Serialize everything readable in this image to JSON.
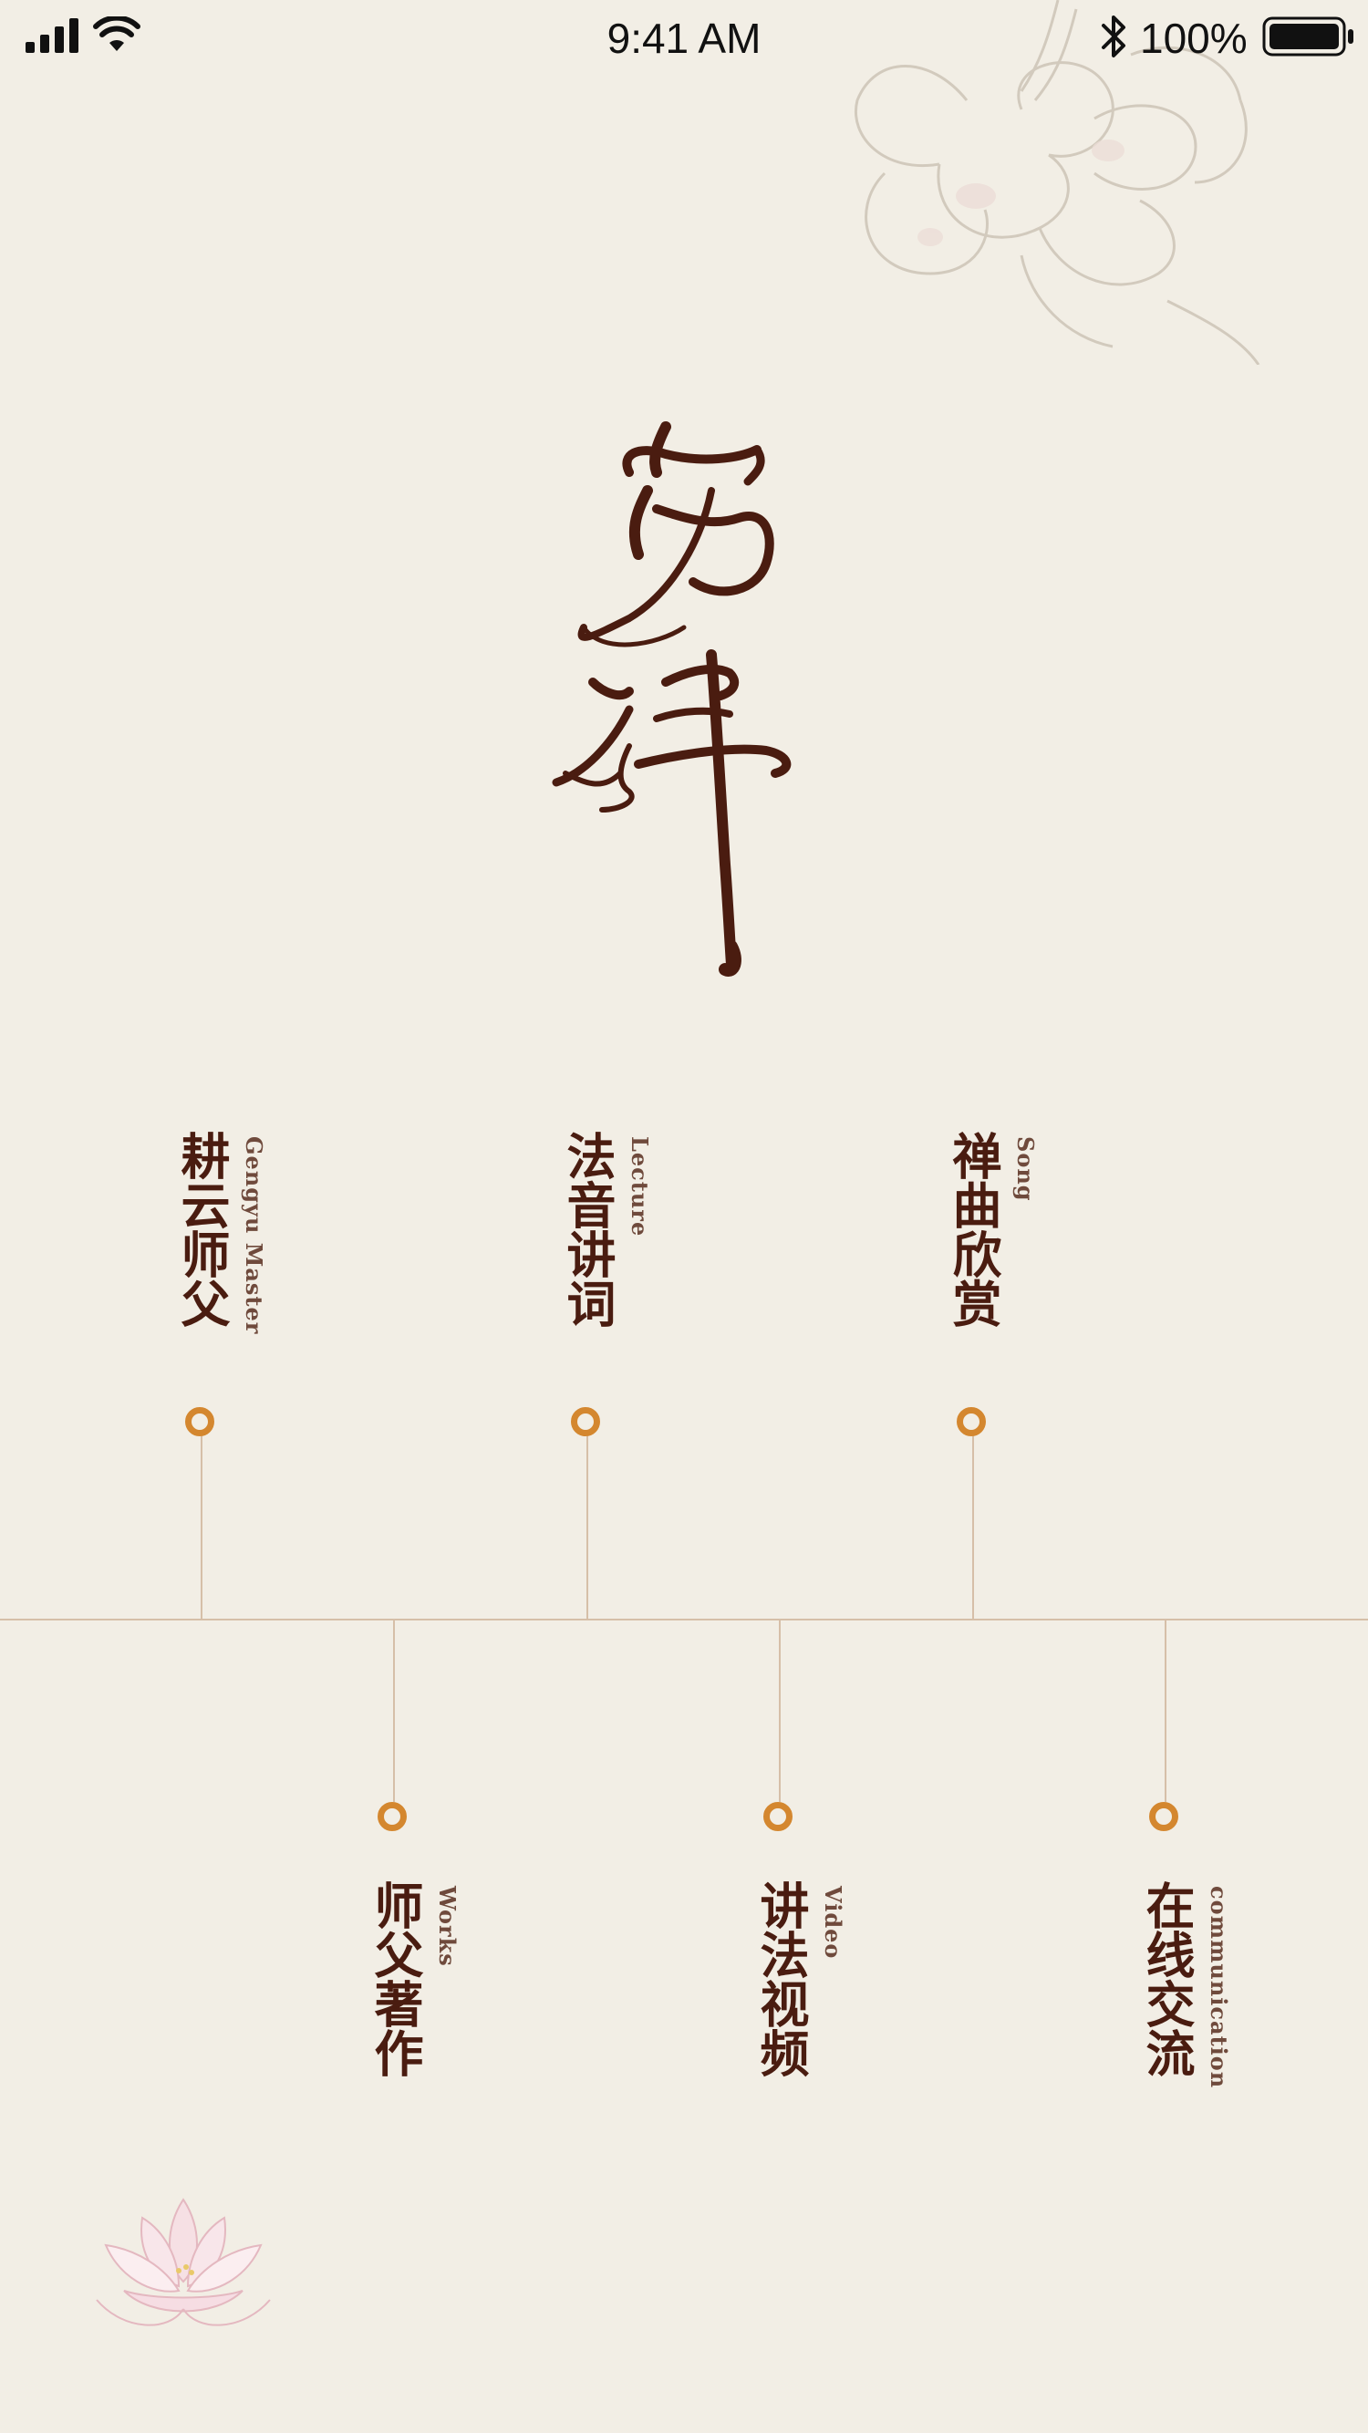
{
  "status_bar": {
    "time": "9:41 AM",
    "battery": "100%",
    "icons": [
      "signal-icon",
      "wifi-icon",
      "bluetooth-icon",
      "battery-icon"
    ]
  },
  "logo": {
    "kind": "calligraphy",
    "text": "安禅"
  },
  "colors": {
    "background": "#f2eee5",
    "text": "#4a1c10",
    "dot": "#d4872f",
    "line": "#d6bfa8"
  },
  "nav": {
    "top": [
      {
        "zh": "耕云师父",
        "en": "Gengyu Master"
      },
      {
        "zh": "法音讲词",
        "en": "Lecture"
      },
      {
        "zh": "禅曲欣赏",
        "en": "Song"
      }
    ],
    "bottom": [
      {
        "zh": "师父著作",
        "en": "Works"
      },
      {
        "zh": "讲法视频",
        "en": "Video"
      },
      {
        "zh": "在线交流",
        "en": "communication"
      }
    ]
  }
}
